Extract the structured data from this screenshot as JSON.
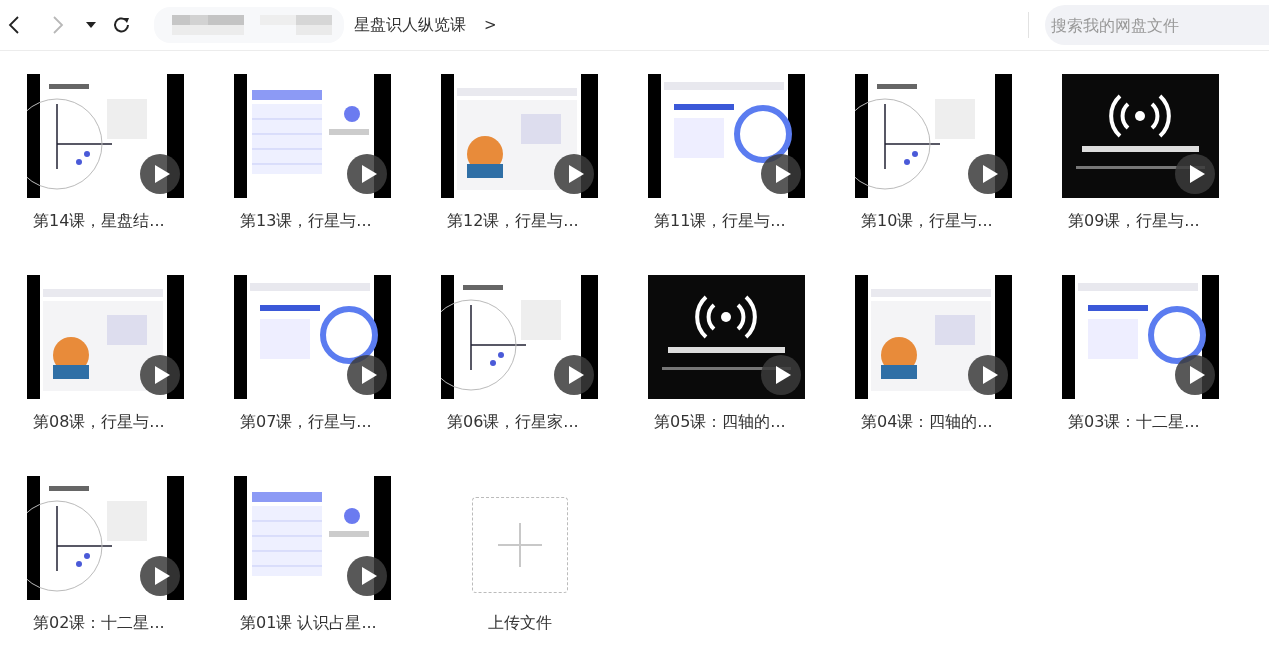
{
  "nav": [
    {
      "kind": "back",
      "disabled": false
    },
    {
      "kind": "forward",
      "disabled": true
    },
    {
      "kind": "history",
      "disabled": false
    },
    {
      "kind": "refresh",
      "disabled": false
    }
  ],
  "breadcrumb": {
    "current": "星盘识人纵览课",
    "separator": ">"
  },
  "search": {
    "placeholder": "搜索我的网盘文件"
  },
  "files": [
    {
      "name": "第14课，星盘结...",
      "kind": "video"
    },
    {
      "name": "第13课，行星与...",
      "kind": "video"
    },
    {
      "name": "第12课，行星与...",
      "kind": "video"
    },
    {
      "name": "第11课，行星与...",
      "kind": "video"
    },
    {
      "name": "第10课，行星与...",
      "kind": "video"
    },
    {
      "name": "第09课，行星与...",
      "kind": "video"
    },
    {
      "name": "第08课，行星与...",
      "kind": "video"
    },
    {
      "name": "第07课，行星与...",
      "kind": "video"
    },
    {
      "name": "第06课，行星家...",
      "kind": "video"
    },
    {
      "name": "第05课：四轴的...",
      "kind": "video"
    },
    {
      "name": "第04课：四轴的...",
      "kind": "video"
    },
    {
      "name": "第03课：十二星...",
      "kind": "video"
    },
    {
      "name": "第02课：十二星...",
      "kind": "video"
    },
    {
      "name": "第01课 认识占星...",
      "kind": "video"
    },
    {
      "name": "上传文件",
      "kind": "upload"
    }
  ]
}
